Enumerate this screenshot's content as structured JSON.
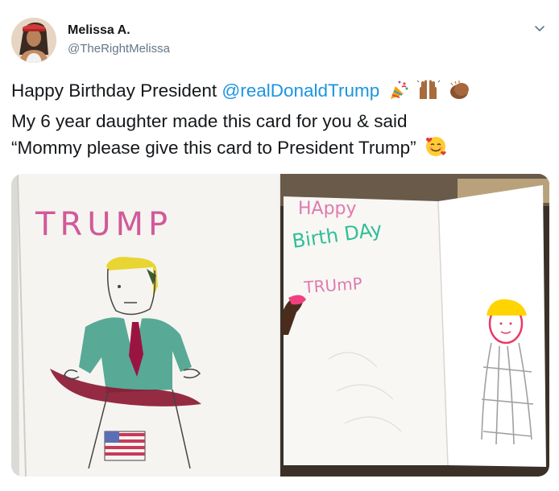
{
  "author": {
    "name": "Melissa A.",
    "handle": "@TheRightMelissa"
  },
  "tweet": {
    "line1_prefix": "Happy Birthday President ",
    "mention": "@realDonaldTrump",
    "line2": "My 6 year daughter made this card for you & said",
    "line3": "“Mommy please give this card to President Trump”"
  },
  "icons": {
    "more": "chevron-down-icon",
    "emojis_line1": [
      "party-popper-icon",
      "raised-hands-icon",
      "clapping-hands-icon"
    ],
    "emoji_line3": "smiling-face-with-hearts-icon"
  },
  "drawing_left": {
    "title": "TRUMP"
  },
  "drawing_right": {
    "line1": "HAppy",
    "line2": "Birth DAy",
    "line3": "TRUmP"
  },
  "colors": {
    "mention": "#1b95e0",
    "name": "#14171a",
    "handle": "#657786"
  }
}
